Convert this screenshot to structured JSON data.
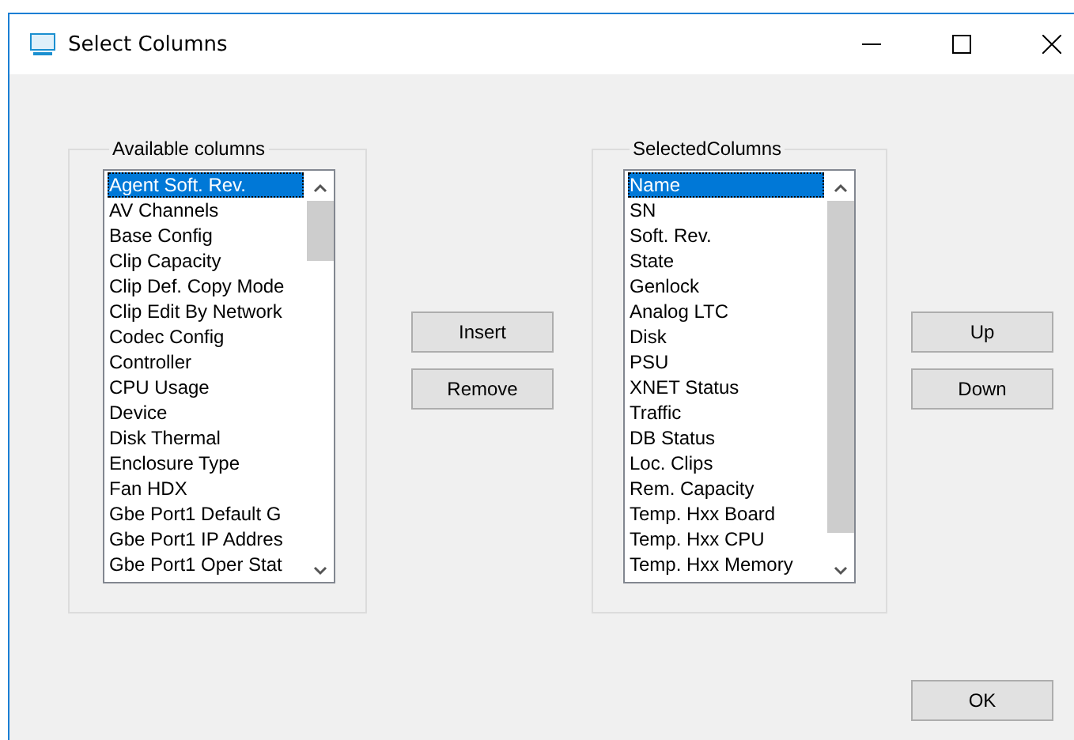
{
  "window": {
    "title": "Select Columns"
  },
  "available": {
    "title": "Available columns",
    "items": [
      {
        "label": "Agent Soft. Rev.",
        "selected": true
      },
      {
        "label": "AV Channels",
        "selected": false
      },
      {
        "label": "Base Config",
        "selected": false
      },
      {
        "label": "Clip Capacity",
        "selected": false
      },
      {
        "label": "Clip Def. Copy Mode",
        "selected": false
      },
      {
        "label": "Clip Edit By Network",
        "selected": false
      },
      {
        "label": "Codec Config",
        "selected": false
      },
      {
        "label": "Controller",
        "selected": false
      },
      {
        "label": "CPU Usage",
        "selected": false
      },
      {
        "label": "Device",
        "selected": false
      },
      {
        "label": "Disk Thermal",
        "selected": false
      },
      {
        "label": "Enclosure Type",
        "selected": false
      },
      {
        "label": "Fan HDX",
        "selected": false
      },
      {
        "label": "Gbe Port1 Default G",
        "selected": false
      },
      {
        "label": "Gbe Port1 IP Addres",
        "selected": false
      },
      {
        "label": "Gbe Port1 Oper Stat",
        "selected": false
      }
    ]
  },
  "transfer_buttons": [
    "Insert",
    "Remove"
  ],
  "selected_columns": {
    "title": "SelectedColumns",
    "items": [
      {
        "label": "Name",
        "selected": true
      },
      {
        "label": "SN",
        "selected": false
      },
      {
        "label": "Soft. Rev.",
        "selected": false
      },
      {
        "label": "State",
        "selected": false
      },
      {
        "label": "Genlock",
        "selected": false
      },
      {
        "label": "Analog LTC",
        "selected": false
      },
      {
        "label": "Disk",
        "selected": false
      },
      {
        "label": "PSU",
        "selected": false
      },
      {
        "label": "XNET Status",
        "selected": false
      },
      {
        "label": "Traffic",
        "selected": false
      },
      {
        "label": "DB Status",
        "selected": false
      },
      {
        "label": "Loc. Clips",
        "selected": false
      },
      {
        "label": "Rem. Capacity",
        "selected": false
      },
      {
        "label": "Temp. Hxx Board",
        "selected": false
      },
      {
        "label": "Temp. Hxx CPU",
        "selected": false
      },
      {
        "label": "Temp. Hxx Memory",
        "selected": false
      }
    ]
  },
  "order_buttons": [
    "Up",
    "Down"
  ],
  "ok_button": "OK"
}
